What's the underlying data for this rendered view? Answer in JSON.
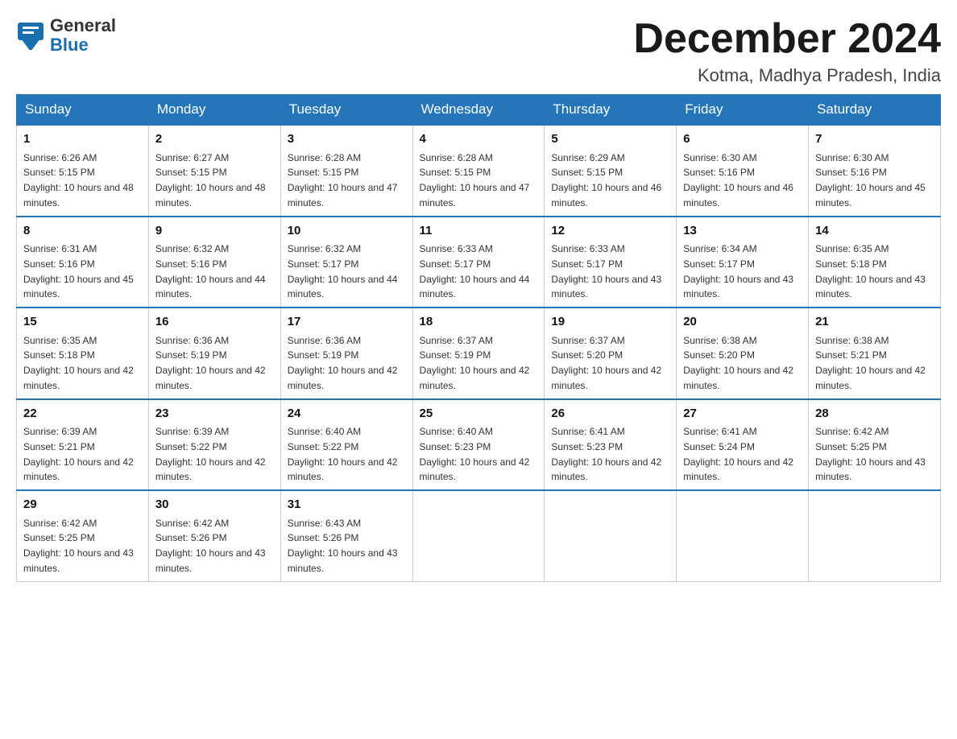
{
  "header": {
    "logo_general": "General",
    "logo_blue": "Blue",
    "month_title": "December 2024",
    "subtitle": "Kotma, Madhya Pradesh, India"
  },
  "days_of_week": [
    "Sunday",
    "Monday",
    "Tuesday",
    "Wednesday",
    "Thursday",
    "Friday",
    "Saturday"
  ],
  "weeks": [
    [
      {
        "num": "1",
        "sunrise": "6:26 AM",
        "sunset": "5:15 PM",
        "daylight": "10 hours and 48 minutes."
      },
      {
        "num": "2",
        "sunrise": "6:27 AM",
        "sunset": "5:15 PM",
        "daylight": "10 hours and 48 minutes."
      },
      {
        "num": "3",
        "sunrise": "6:28 AM",
        "sunset": "5:15 PM",
        "daylight": "10 hours and 47 minutes."
      },
      {
        "num": "4",
        "sunrise": "6:28 AM",
        "sunset": "5:15 PM",
        "daylight": "10 hours and 47 minutes."
      },
      {
        "num": "5",
        "sunrise": "6:29 AM",
        "sunset": "5:15 PM",
        "daylight": "10 hours and 46 minutes."
      },
      {
        "num": "6",
        "sunrise": "6:30 AM",
        "sunset": "5:16 PM",
        "daylight": "10 hours and 46 minutes."
      },
      {
        "num": "7",
        "sunrise": "6:30 AM",
        "sunset": "5:16 PM",
        "daylight": "10 hours and 45 minutes."
      }
    ],
    [
      {
        "num": "8",
        "sunrise": "6:31 AM",
        "sunset": "5:16 PM",
        "daylight": "10 hours and 45 minutes."
      },
      {
        "num": "9",
        "sunrise": "6:32 AM",
        "sunset": "5:16 PM",
        "daylight": "10 hours and 44 minutes."
      },
      {
        "num": "10",
        "sunrise": "6:32 AM",
        "sunset": "5:17 PM",
        "daylight": "10 hours and 44 minutes."
      },
      {
        "num": "11",
        "sunrise": "6:33 AM",
        "sunset": "5:17 PM",
        "daylight": "10 hours and 44 minutes."
      },
      {
        "num": "12",
        "sunrise": "6:33 AM",
        "sunset": "5:17 PM",
        "daylight": "10 hours and 43 minutes."
      },
      {
        "num": "13",
        "sunrise": "6:34 AM",
        "sunset": "5:17 PM",
        "daylight": "10 hours and 43 minutes."
      },
      {
        "num": "14",
        "sunrise": "6:35 AM",
        "sunset": "5:18 PM",
        "daylight": "10 hours and 43 minutes."
      }
    ],
    [
      {
        "num": "15",
        "sunrise": "6:35 AM",
        "sunset": "5:18 PM",
        "daylight": "10 hours and 42 minutes."
      },
      {
        "num": "16",
        "sunrise": "6:36 AM",
        "sunset": "5:19 PM",
        "daylight": "10 hours and 42 minutes."
      },
      {
        "num": "17",
        "sunrise": "6:36 AM",
        "sunset": "5:19 PM",
        "daylight": "10 hours and 42 minutes."
      },
      {
        "num": "18",
        "sunrise": "6:37 AM",
        "sunset": "5:19 PM",
        "daylight": "10 hours and 42 minutes."
      },
      {
        "num": "19",
        "sunrise": "6:37 AM",
        "sunset": "5:20 PM",
        "daylight": "10 hours and 42 minutes."
      },
      {
        "num": "20",
        "sunrise": "6:38 AM",
        "sunset": "5:20 PM",
        "daylight": "10 hours and 42 minutes."
      },
      {
        "num": "21",
        "sunrise": "6:38 AM",
        "sunset": "5:21 PM",
        "daylight": "10 hours and 42 minutes."
      }
    ],
    [
      {
        "num": "22",
        "sunrise": "6:39 AM",
        "sunset": "5:21 PM",
        "daylight": "10 hours and 42 minutes."
      },
      {
        "num": "23",
        "sunrise": "6:39 AM",
        "sunset": "5:22 PM",
        "daylight": "10 hours and 42 minutes."
      },
      {
        "num": "24",
        "sunrise": "6:40 AM",
        "sunset": "5:22 PM",
        "daylight": "10 hours and 42 minutes."
      },
      {
        "num": "25",
        "sunrise": "6:40 AM",
        "sunset": "5:23 PM",
        "daylight": "10 hours and 42 minutes."
      },
      {
        "num": "26",
        "sunrise": "6:41 AM",
        "sunset": "5:23 PM",
        "daylight": "10 hours and 42 minutes."
      },
      {
        "num": "27",
        "sunrise": "6:41 AM",
        "sunset": "5:24 PM",
        "daylight": "10 hours and 42 minutes."
      },
      {
        "num": "28",
        "sunrise": "6:42 AM",
        "sunset": "5:25 PM",
        "daylight": "10 hours and 43 minutes."
      }
    ],
    [
      {
        "num": "29",
        "sunrise": "6:42 AM",
        "sunset": "5:25 PM",
        "daylight": "10 hours and 43 minutes."
      },
      {
        "num": "30",
        "sunrise": "6:42 AM",
        "sunset": "5:26 PM",
        "daylight": "10 hours and 43 minutes."
      },
      {
        "num": "31",
        "sunrise": "6:43 AM",
        "sunset": "5:26 PM",
        "daylight": "10 hours and 43 minutes."
      },
      null,
      null,
      null,
      null
    ]
  ]
}
